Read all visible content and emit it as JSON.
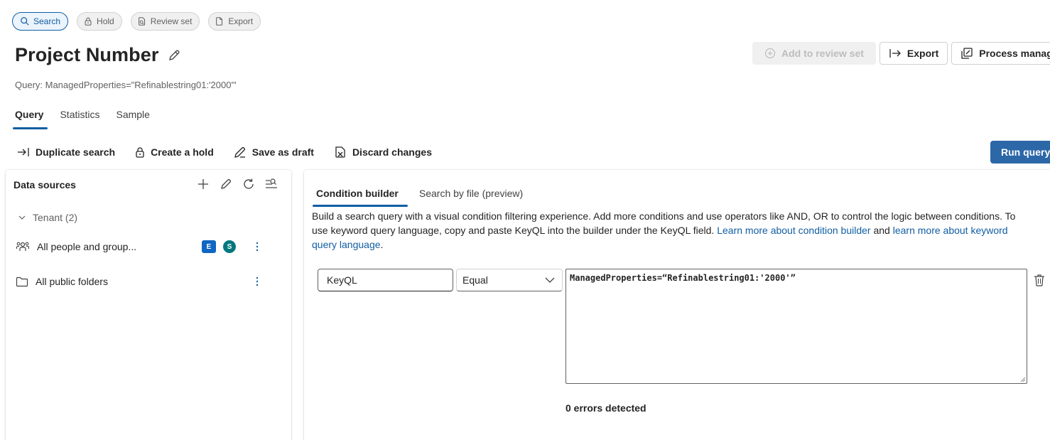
{
  "top_pills": [
    {
      "label": "Search",
      "icon": "search-icon",
      "active": true
    },
    {
      "label": "Hold",
      "icon": "lock-icon",
      "active": false
    },
    {
      "label": "Review set",
      "icon": "review-set-icon",
      "active": false
    },
    {
      "label": "Export",
      "icon": "document-icon",
      "active": false
    }
  ],
  "header": {
    "title": "Project Number",
    "query_text": "Query: ManagedProperties=\"Refinablestring01:'2000'\"",
    "add_to_review_set": "Add to review set",
    "export": "Export",
    "process_manager": "Process manager"
  },
  "tabs": [
    {
      "label": "Query",
      "active": true
    },
    {
      "label": "Statistics",
      "active": false
    },
    {
      "label": "Sample",
      "active": false
    }
  ],
  "toolbar": {
    "duplicate": "Duplicate search",
    "create_hold": "Create a hold",
    "save_draft": "Save as draft",
    "discard": "Discard changes",
    "run_query": "Run query"
  },
  "data_sources": {
    "title": "Data sources",
    "tenant": "Tenant (2)",
    "items": [
      {
        "name": "All people and group...",
        "icon": "people-group-icon",
        "badges": [
          "E",
          "S"
        ]
      },
      {
        "name": "All public folders",
        "icon": "folder-icon",
        "badges": []
      }
    ]
  },
  "condition_builder": {
    "tabs": [
      {
        "label": "Condition builder",
        "active": true
      },
      {
        "label": "Search by file (preview)",
        "active": false
      }
    ],
    "description_text": "Build a search query with a visual condition filtering experience. Add more conditions and use operators like AND, OR to control the logic between conditions. To use keyword query language, copy and paste KeyQL into the builder under the KeyQL field.",
    "link1": "Learn more about condition builder",
    "and_text": "and",
    "link2": "learn more about keyword query language",
    "period": ".",
    "field_value": "KeyQL",
    "operator_value": "Equal",
    "query_value": "ManagedProperties=“Refinablestring01:'2000'”",
    "errors": "0 errors detected"
  },
  "colors": {
    "accent": "#115ea3",
    "primary_button": "#2c67a8"
  }
}
